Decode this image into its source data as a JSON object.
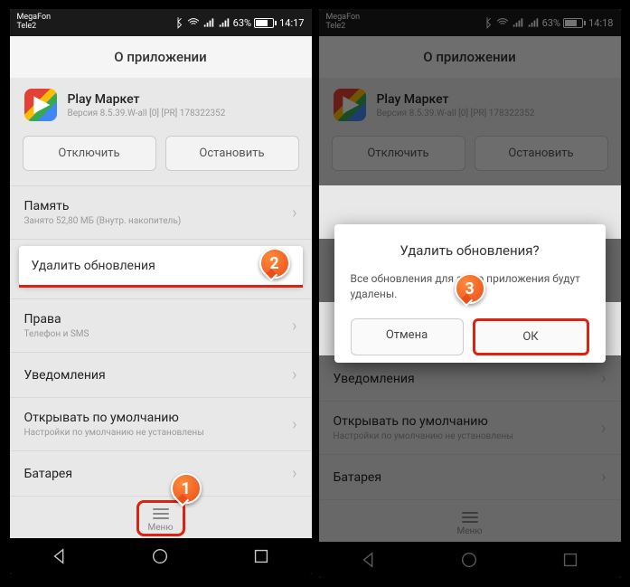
{
  "status": {
    "carrier1": "MegaFon",
    "carrier2": "Tele2",
    "battery_pct": "63%",
    "time": "14:17",
    "time2": "14:18"
  },
  "screen_title": "О приложении",
  "app": {
    "name": "Play Маркет",
    "version": "Версия 8.5.39.W-all [0] [PR] 178322352"
  },
  "buttons": {
    "disable": "Отключить",
    "stop": "Остановить"
  },
  "rows": {
    "memory": {
      "title": "Память",
      "sub": "Занято 52,80 МБ (Внутр. накопитель)"
    },
    "delete_updates": "Удалить обновления",
    "rights": {
      "title": "Права",
      "sub": "Телефон и SMS"
    },
    "notifications": "Уведомления",
    "open_default": {
      "title": "Открывать по умолчанию",
      "sub": "Настройки по умолчанию не установлены"
    },
    "battery": "Батарея"
  },
  "menu_label": "Меню",
  "dialog": {
    "title": "Удалить обновления?",
    "body": "Все обновления для этого приложения будут удалены.",
    "cancel": "Отмена",
    "ok": "ОК"
  },
  "callouts": {
    "one": "1",
    "two": "2",
    "three": "3"
  }
}
